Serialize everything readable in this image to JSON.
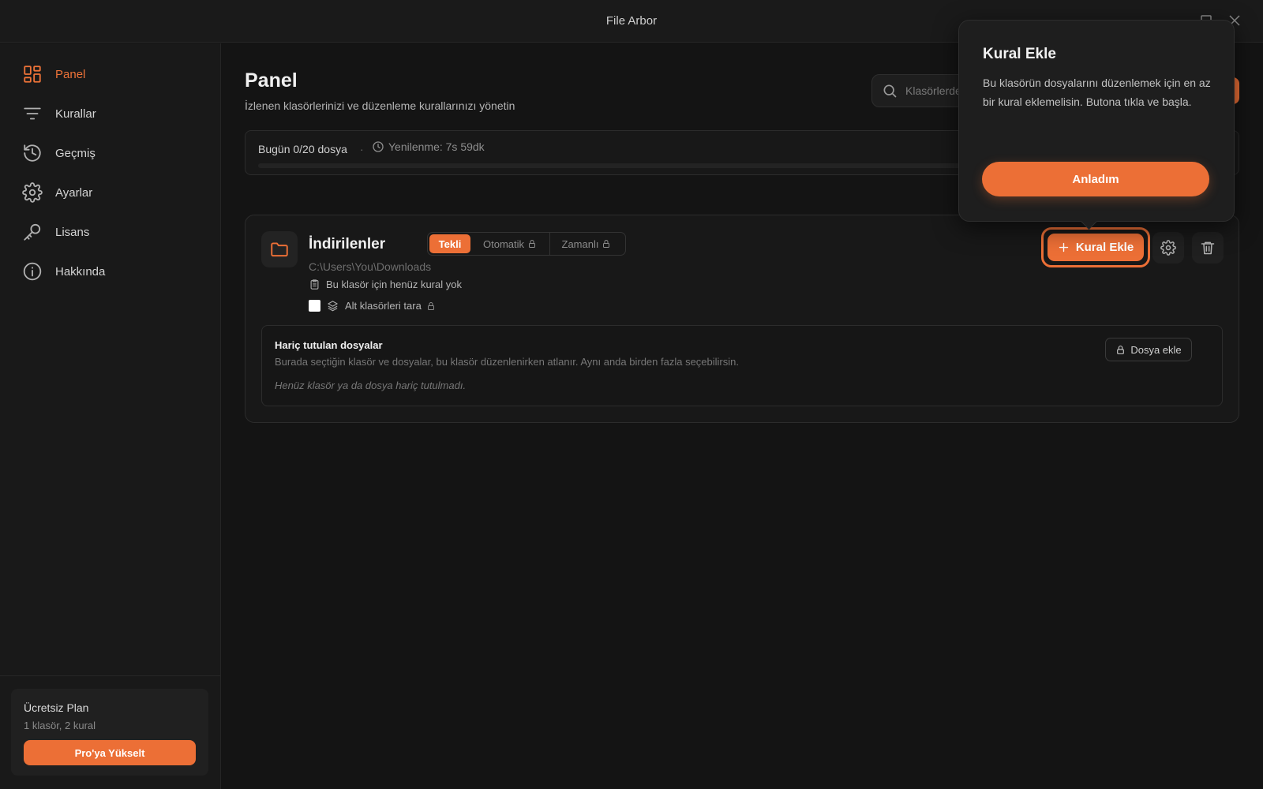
{
  "window": {
    "title": "File Arbor"
  },
  "sidebar": {
    "items": [
      {
        "label": "Panel",
        "icon": "dashboard-icon",
        "active": true
      },
      {
        "label": "Kurallar",
        "icon": "filter-icon"
      },
      {
        "label": "Geçmiş",
        "icon": "history-icon"
      },
      {
        "label": "Ayarlar",
        "icon": "gear-icon"
      },
      {
        "label": "Lisans",
        "icon": "key-icon"
      },
      {
        "label": "Hakkında",
        "icon": "info-icon"
      }
    ],
    "plan": {
      "title": "Ücretsiz Plan",
      "usage": "1 klasör, 2 kural",
      "upgrade_label": "Pro'ya Yükselt"
    }
  },
  "header": {
    "title": "Panel",
    "subtitle": "İzlenen klasörlerinizi ve düzenleme kurallarınızı yönetin",
    "search_placeholder": "Klasörlerde ara"
  },
  "quota": {
    "today": "Bugün 0/20 dosya",
    "separator": "·",
    "renewal": "Yenilenme: 7s 59dk",
    "progress": 0
  },
  "folder": {
    "name": "İndirilenler",
    "path": "C:\\Users\\You\\Downloads",
    "modes": [
      {
        "label": "Tekli",
        "active": true
      },
      {
        "label": "Otomatik",
        "locked": true
      },
      {
        "label": "Zamanlı",
        "locked": true
      }
    ],
    "no_rules": "Bu klasör için henüz kural yok",
    "scan_subfolders": {
      "label": "Alt klasörleri tara",
      "checked": false,
      "locked": true
    },
    "add_rule_label": "Kural Ekle",
    "excluded": {
      "title": "Hariç tutulan dosyalar",
      "description": "Burada seçtiğin klasör ve dosyalar, bu klasör düzenlenirken atlanır. Aynı anda birden fazla seçebilirsin.",
      "empty": "Henüz klasör ya da dosya hariç tutulmadı.",
      "add_label": "Dosya ekle"
    }
  },
  "popover": {
    "title": "Kural Ekle",
    "body": "Bu klasörün dosyalarını düzenlemek için en az bir kural eklemelisin. Butona tıkla ve başla.",
    "button": "Anladım"
  },
  "colors": {
    "accent": "#ec6f36",
    "background": "#141414",
    "sidebar": "#191919"
  }
}
